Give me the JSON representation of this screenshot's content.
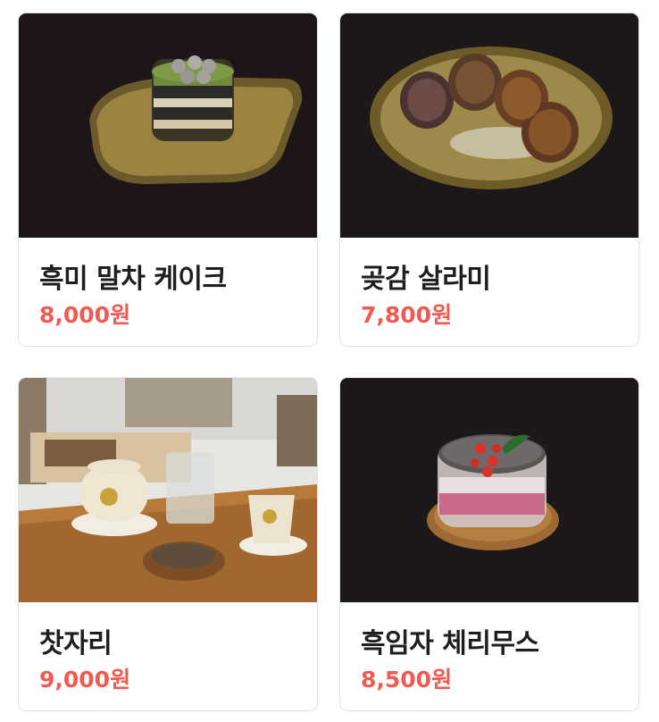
{
  "products": [
    {
      "name": "흑미 말차 케이크",
      "price": "8,000원",
      "image": "black-rice-matcha-cake-photo"
    },
    {
      "name": "곶감 살라미",
      "price": "7,800원",
      "image": "dried-persimmon-salami-photo"
    },
    {
      "name": "찻자리",
      "price": "9,000원",
      "image": "tea-table-setting-photo"
    },
    {
      "name": "흑임자 체리무스",
      "price": "8,500원",
      "image": "black-sesame-cherry-mousse-photo"
    }
  ],
  "colors": {
    "price": "#f05a50",
    "name": "#1e1e1e",
    "border": "#e3e3e3"
  }
}
